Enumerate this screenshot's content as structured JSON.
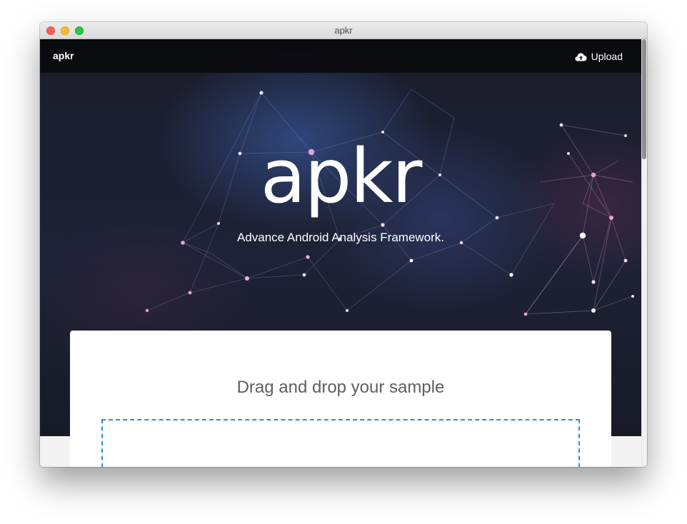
{
  "window": {
    "title": "apkr"
  },
  "navbar": {
    "brand": "apkr",
    "upload_label": "Upload",
    "upload_icon": "cloud-upload-icon"
  },
  "hero": {
    "logo_text": "apkr",
    "tagline": "Advance Android Analysis Framework."
  },
  "upload_card": {
    "title": "Drag and drop your sample"
  },
  "colors": {
    "accent": "#2a8fd6",
    "navbar_bg": "#0a0a0c",
    "hero_bg": "#1e2236"
  }
}
